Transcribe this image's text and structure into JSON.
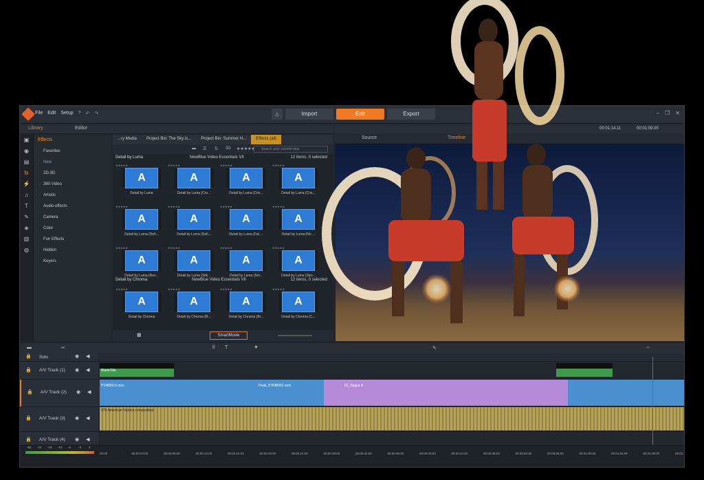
{
  "menu": {
    "file": "File",
    "edit": "Edit",
    "setup": "Setup"
  },
  "modes": {
    "import": "Import",
    "edit": "Edit",
    "export": "Export"
  },
  "tabs": {
    "library": "Library",
    "editor": "Editor"
  },
  "categories": {
    "header": "Effects",
    "items": [
      "Favorites",
      "New",
      "2D-3D",
      "360 Video",
      "Artistic",
      "Audio effects",
      "Camera",
      "Color",
      "Fun Effects",
      "Hidden",
      "Keyers"
    ]
  },
  "bin_tabs": [
    "...ry Media",
    "Project Bin: The Sky is...",
    "Project Bin: Summer H...",
    "Effects (all)"
  ],
  "search_placeholder": "Search your current view",
  "groups": [
    {
      "name": "Detail by Luma",
      "vendor": "NewBlue Video Essentials VII",
      "count": "12 items, 0 selected",
      "labels": [
        "Detail by Luma",
        "Detail by Luma (Cro...",
        "Detail by Luma (Cris...",
        "Detail by Luma (Cris...",
        "Detail by Luma (Defi...",
        "Detail by Luma (Defi...",
        "Detail by Luma (Fat ...",
        "Detail by Luma (No ...",
        "Detail by Luma (Res...",
        "Detail by Luma (Silk...",
        "Detail by Luma (Sm...",
        "Detail by Luma (Stro..."
      ]
    },
    {
      "name": "Detail by Chroma",
      "vendor": "NewBlue Video Essentials VII",
      "count": "12 items, 0 selected",
      "labels": [
        "Detail by Chroma",
        "Detail by Chroma (B...",
        "Detail by Chroma (Br...",
        "Detail by Chroma (C..."
      ]
    }
  ],
  "smartmovie": "SmartMovie",
  "preview": {
    "source_tab": "Source",
    "timeline_tab": "Timeline",
    "timecode1": "00:01:14.11",
    "timecode2": "00:01:09.00"
  },
  "tracks": [
    {
      "name": "Solo"
    },
    {
      "name": "A/V Track (1)"
    },
    {
      "name": "A/V Track (2)"
    },
    {
      "name": "A/V Track (3)"
    },
    {
      "name": "A/V Track (4)"
    }
  ],
  "clips": {
    "title1": "BlankTitle",
    "clipA": "P1480915.mov",
    "clipB": "Peak_97648002.mov",
    "clipC": "02_Segue A",
    "audio": "076 American Visions.compositeat"
  },
  "ruler": [
    "00:00",
    "00:00:04:00",
    "00:00:08:00",
    "00:00:12:00",
    "00:00:16:00",
    "00:00:20:00",
    "00:00:24:00",
    "00:00:28:00",
    "00:00:32:00",
    "00:00:36:00",
    "00:00:40:00",
    "00:00:44:00",
    "00:00:48:00",
    "00:00:52:00",
    "00:00:56:00",
    "00:01:00:00",
    "00:01:04:00",
    "00:01:08:00",
    "00:01:12:00"
  ],
  "meter_labels": [
    "-60",
    "-22",
    "-16",
    "-10",
    "-6",
    "-3",
    "0"
  ],
  "accent": "#f07a22"
}
